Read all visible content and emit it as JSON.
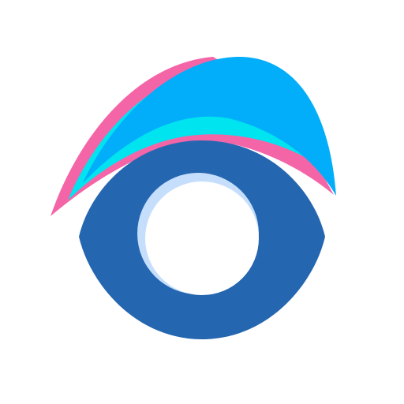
{
  "icon": {
    "name": "eye-logo-icon",
    "colors": {
      "background": "#ffffff",
      "pink_wave": "#f465a8",
      "cyan_wave": "#00e4f0",
      "blue_wave": "#02aefa",
      "eye_body": "#2566b0",
      "pupil_highlight": "#c5defc",
      "pupil_center": "#ffffff"
    }
  }
}
